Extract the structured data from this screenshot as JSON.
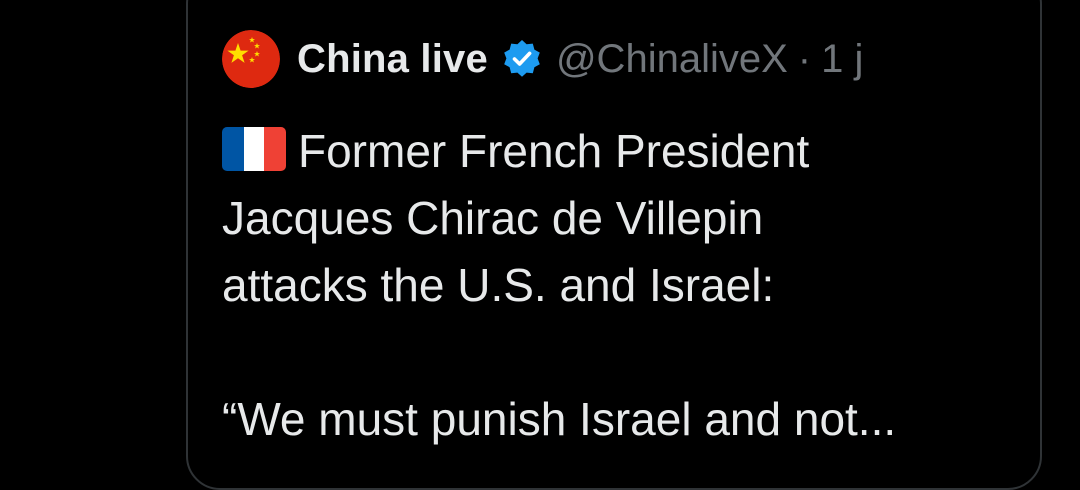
{
  "post": {
    "author": {
      "display_name": "China live",
      "handle": "@ChinaliveX",
      "separator": "·",
      "timestamp": "1 j",
      "avatar_icon": "china-flag-icon",
      "verified_icon": "verified-badge-icon"
    },
    "text": {
      "flag_icon": "france-flag-icon",
      "lines": [
        "Former French President",
        "Jacques Chirac de Villepin",
        "attacks the U.S. and Israel:",
        "",
        "“We must punish Israel and not..."
      ]
    }
  },
  "colors": {
    "background": "#000000",
    "text_primary": "#e7e9ea",
    "text_secondary": "#71767b",
    "border": "#2f3336",
    "verified_blue": "#1d9bf0",
    "china_red": "#de2910",
    "china_yellow": "#ffde00",
    "france_blue": "#0055a4",
    "france_white": "#ffffff",
    "france_red": "#ef4135"
  }
}
